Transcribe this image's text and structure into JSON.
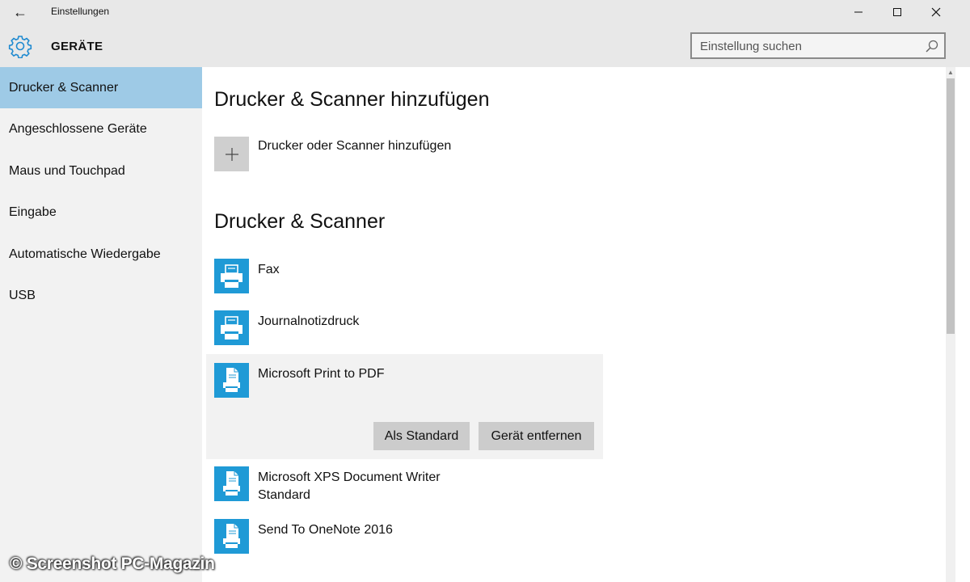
{
  "window": {
    "title": "Einstellungen",
    "back_glyph": "←",
    "minimize_glyph": "—",
    "maximize_glyph": "☐",
    "close_glyph": "✕"
  },
  "header": {
    "section_title": "GERÄTE",
    "section_icon": "gear-icon",
    "search_placeholder": "Einstellung suchen",
    "search_value": ""
  },
  "sidebar": {
    "items": [
      {
        "label": "Drucker & Scanner",
        "active": true
      },
      {
        "label": "Angeschlossene Geräte",
        "active": false
      },
      {
        "label": "Maus und Touchpad",
        "active": false
      },
      {
        "label": "Eingabe",
        "active": false
      },
      {
        "label": "Automatische Wiedergabe",
        "active": false
      },
      {
        "label": "USB",
        "active": false
      }
    ]
  },
  "main": {
    "add_section_title": "Drucker & Scanner hinzufügen",
    "add_button_label": "Drucker oder Scanner hinzufügen",
    "add_icon": "plus-icon",
    "list_section_title": "Drucker & Scanner",
    "printers": [
      {
        "name": "Fax",
        "status": "",
        "icon": "printer-icon"
      },
      {
        "name": "Journalnotizdruck",
        "status": "",
        "icon": "printer-icon"
      },
      {
        "name": "Microsoft Print to PDF",
        "status": "",
        "icon": "document-printer-icon",
        "selected": true
      },
      {
        "name": "Microsoft XPS Document Writer",
        "status": "Standard",
        "icon": "document-printer-icon"
      },
      {
        "name": "Send To OneNote 2016",
        "status": "",
        "icon": "document-printer-icon"
      }
    ],
    "selected_actions": {
      "set_default_label": "Als Standard",
      "remove_label": "Gerät entfernen"
    }
  },
  "watermark": "© Screenshot PC-Magazin",
  "colors": {
    "accent": "#1f9ad6",
    "sidebar_active": "#9ecae6",
    "chrome": "#e8e8e8",
    "sidebar_bg": "#f2f2f2",
    "button_bg": "#cccccc"
  }
}
